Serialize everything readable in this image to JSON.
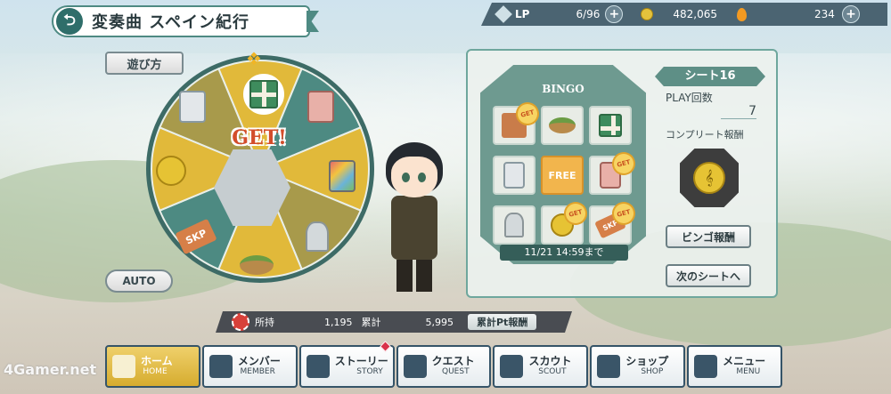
{
  "header": {
    "title": "変奏曲 スペイン紀行",
    "back_icon": "back-arrow-icon"
  },
  "status": {
    "lp_label": "LP",
    "lp_value": "6/96",
    "coins": "482,065",
    "drops": "234"
  },
  "roulette": {
    "how_to_label": "遊び方",
    "auto_label": "AUTO",
    "get_text": "GET!",
    "skp_text": "SKP"
  },
  "bingo": {
    "board_title": "BINGO",
    "free_label": "FREE",
    "get_badge": "GET",
    "deadline": "11/21 14:59まで",
    "sheet_title": "シート16",
    "play_count_label": "PLAY回数",
    "play_count": "7",
    "complete_reward_label": "コンプリート報酬",
    "bingo_reward_button": "ビンゴ報酬",
    "next_sheet_button": "次のシートへ"
  },
  "points": {
    "owned_label": "所持",
    "owned_value": "1,195",
    "total_label": "累計",
    "total_value": "5,995",
    "cumulative_button": "累計Pt報酬"
  },
  "nav": [
    {
      "jp": "ホーム",
      "en": "HOME",
      "icon": "home-icon"
    },
    {
      "jp": "メンバー",
      "en": "MEMBER",
      "icon": "members-icon"
    },
    {
      "jp": "ストーリー",
      "en": "STORY",
      "icon": "book-icon"
    },
    {
      "jp": "クエスト",
      "en": "QUEST",
      "icon": "signpost-icon"
    },
    {
      "jp": "スカウト",
      "en": "SCOUT",
      "icon": "bus-icon"
    },
    {
      "jp": "ショップ",
      "en": "SHOP",
      "icon": "shop-icon"
    },
    {
      "jp": "メニュー",
      "en": "MENU",
      "icon": "grid-menu-icon"
    }
  ],
  "watermark": "4Gamer.net",
  "colors": {
    "wheel_teal": "#4d8a82",
    "wheel_gold": "#a89a4b",
    "accent_gold": "#e1b93a",
    "panel_border": "#6ea79d"
  }
}
